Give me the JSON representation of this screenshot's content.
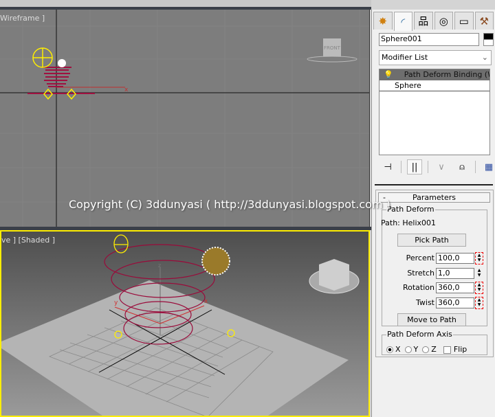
{
  "viewports": {
    "top": {
      "label": "Wireframe ]",
      "viewcube_label": "FRONT"
    },
    "bottom": {
      "label": "ve ] [Shaded ]"
    }
  },
  "watermark": "Copyright (C) 3ddunyasi ( http://3ddunyasi.blogspot.com )",
  "panel": {
    "tabs": [
      {
        "icon": "create-icon",
        "glyph": "✸"
      },
      {
        "icon": "modify-icon",
        "glyph": "◜"
      },
      {
        "icon": "hierarchy-icon",
        "glyph": "品"
      },
      {
        "icon": "motion-icon",
        "glyph": "◎"
      },
      {
        "icon": "display-icon",
        "glyph": "▭"
      },
      {
        "icon": "utilities-icon",
        "glyph": "⚒"
      }
    ],
    "object_name": "Sphere001",
    "object_color": "#000000",
    "modifier_list": "Modifier List",
    "stack": [
      {
        "label": "Path Deform Binding (WSM)",
        "selected": true
      },
      {
        "label": "Sphere",
        "selected": false
      }
    ],
    "parameters": {
      "title": "Parameters",
      "collapse": "-",
      "group_path_deform": "Path Deform",
      "path_label": "Path: Helix001",
      "pick_path": "Pick Path",
      "fields": [
        {
          "label": "Percent",
          "value": "100,0",
          "keyed": true
        },
        {
          "label": "Stretch",
          "value": "1,0",
          "keyed": false
        },
        {
          "label": "Rotation",
          "value": "360,0",
          "keyed": true
        },
        {
          "label": "Twist",
          "value": "360,0",
          "keyed": true
        }
      ],
      "move_to_path": "Move to Path",
      "group_axis": "Path Deform Axis",
      "axes": [
        {
          "label": "X",
          "selected": true
        },
        {
          "label": "Y",
          "selected": false
        },
        {
          "label": "Z",
          "selected": false
        }
      ],
      "flip": {
        "label": "Flip",
        "checked": false
      }
    }
  }
}
